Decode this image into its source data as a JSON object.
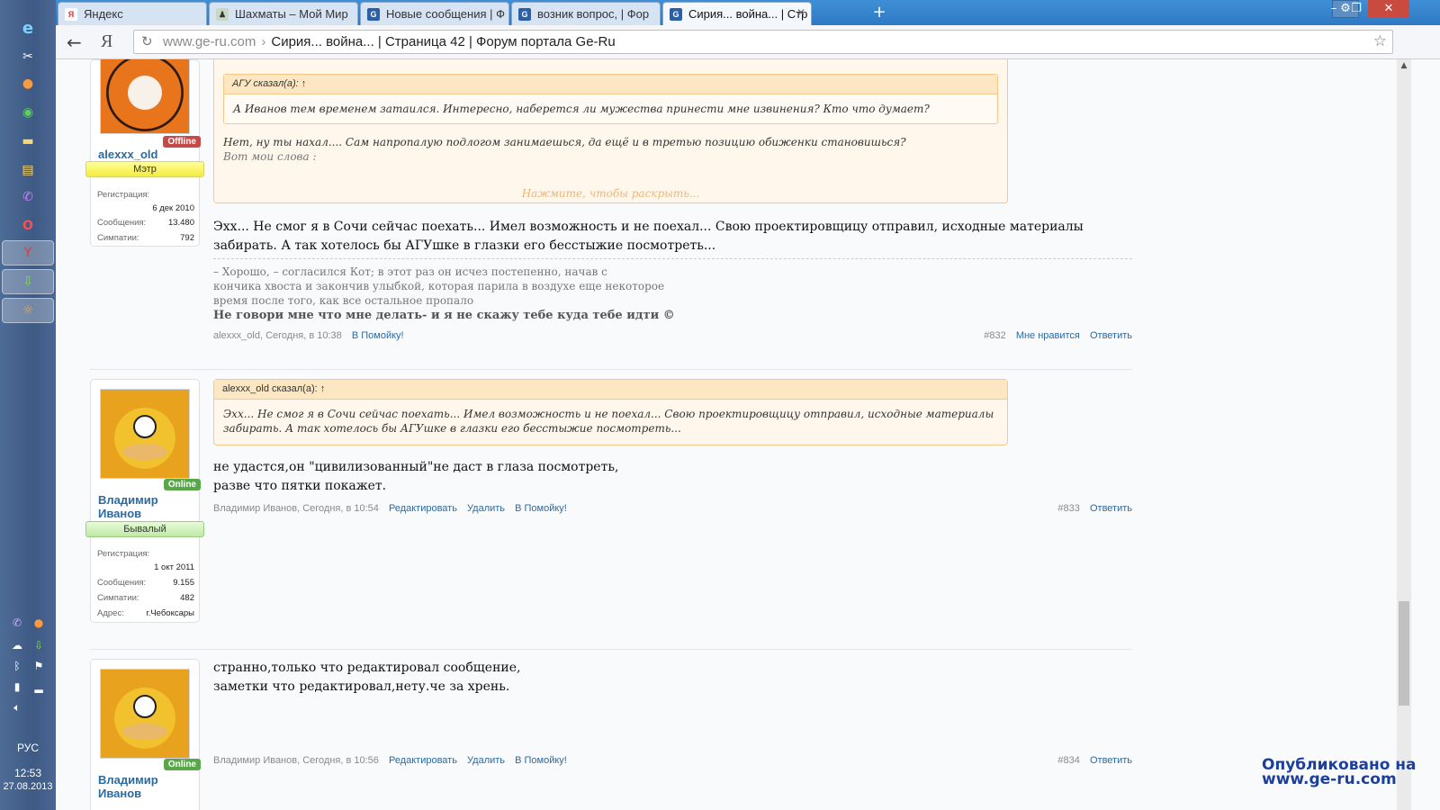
{
  "taskbar": {
    "language": "РУС",
    "time": "12:53",
    "date": "27.08.2013"
  },
  "tabs": [
    {
      "label": "Яндекс",
      "favicon": "Я",
      "color": "#d33"
    },
    {
      "label": "Шахматы – Мой Мир",
      "favicon": "♟",
      "color": "#8a7"
    },
    {
      "label": "Новые сообщения | Ф",
      "favicon": "G",
      "color": "#2b5fa8"
    },
    {
      "label": "возник вопрос, | Фор",
      "favicon": "G",
      "color": "#2b5fa8"
    },
    {
      "label": "Сирия... война... | Стр",
      "favicon": "G",
      "color": "#2b5fa8"
    }
  ],
  "address": {
    "host": "www.ge-ru.com",
    "separator": "›",
    "title": "Сирия... война... | Страница 42 | Форум портала Ge-Ru"
  },
  "posts": [
    {
      "user": {
        "name": "alexxx_old",
        "status": "Offline",
        "title": "Мэтр",
        "stats": [
          {
            "label": "Регистрация:",
            "value": ""
          },
          {
            "label": "",
            "value": "6 дек 2010"
          },
          {
            "label": "Сообщения:",
            "value": "13.480"
          },
          {
            "label": "Симпатии:",
            "value": "792"
          }
        ]
      },
      "quote": {
        "inner_head": "АГУ сказал(а): ↑",
        "inner_text": "А Иванов тем временем затаился. Интересно, наберется ли мужества принести мне извинения? Кто что думает?",
        "line1": "Нет, ну ты нахал.... Сам напропалую подлогом занимаешься, да ещё и в третью позицию обиженки становишься?",
        "line2": "Вот мои слова :",
        "expand": "Нажмите, чтобы раскрыть..."
      },
      "message": "Эхх... Не смог я в Сочи сейчас поехать... Имел возможность и не поехал... Свою проектировщицу отправил, исходные материалы забирать. А так хотелось бы АГУшке в глазки его бесстыжие посмотреть...",
      "signature": {
        "line1": "– Хорошо, – согласился Кот; в этот раз он исчез постепенно, начав с",
        "line2": "кончика хвоста и закончив улыбкой, которая парила в воздухе еще некоторое",
        "line3": "время после того, как все остальное пропало",
        "bold": "Не говори мне что мне делать- и я не скажу тебе куда тебе идти ©"
      },
      "meta": {
        "author_time": "alexxx_old, Сегодня, в 10:38",
        "links": [
          "В Помойку!"
        ],
        "number": "#832",
        "right_links": [
          "Мне нравится",
          "Ответить"
        ]
      }
    },
    {
      "user": {
        "name": "Владимир Иванов",
        "status": "Online",
        "title": "Бывалый",
        "stats": [
          {
            "label": "Регистрация:",
            "value": ""
          },
          {
            "label": "",
            "value": "1 окт 2011"
          },
          {
            "label": "Сообщения:",
            "value": "9.155"
          },
          {
            "label": "Симпатии:",
            "value": "482"
          },
          {
            "label": "Адрес:",
            "value": "г.Чебоксары"
          }
        ]
      },
      "quote": {
        "head": "alexxx_old сказал(а): ↑",
        "text": "Эхх... Не смог я в Сочи сейчас поехать... Имел возможность и не поехал... Свою проектировщицу отправил, исходные материалы забирать. А так хотелось бы АГУшке в глазки его бесстыжие посмотреть..."
      },
      "message_line1": "не удастся,он \"цивилизованный\"не даст в глаза посмотреть,",
      "message_line2": "разве что пятки покажет.",
      "meta": {
        "author_time": "Владимир Иванов, Сегодня, в 10:54",
        "links": [
          "Редактировать",
          "Удалить",
          "В Помойку!"
        ],
        "number": "#833",
        "right_links": [
          "Ответить"
        ]
      }
    },
    {
      "user": {
        "name": "Владимир Иванов",
        "status": "Online"
      },
      "message_line1": "странно,только что редактировал сообщение,",
      "message_line2": "заметки что редактировал,нету.че за хрень.",
      "meta": {
        "author_time": "Владимир Иванов, Сегодня, в 10:56",
        "links": [
          "Редактировать",
          "Удалить",
          "В Помойку!"
        ],
        "number": "#834",
        "right_links": [
          "Ответить"
        ]
      }
    }
  ],
  "watermark": {
    "line1": "Опубликовано на",
    "line2": "www.ge-ru.com"
  }
}
